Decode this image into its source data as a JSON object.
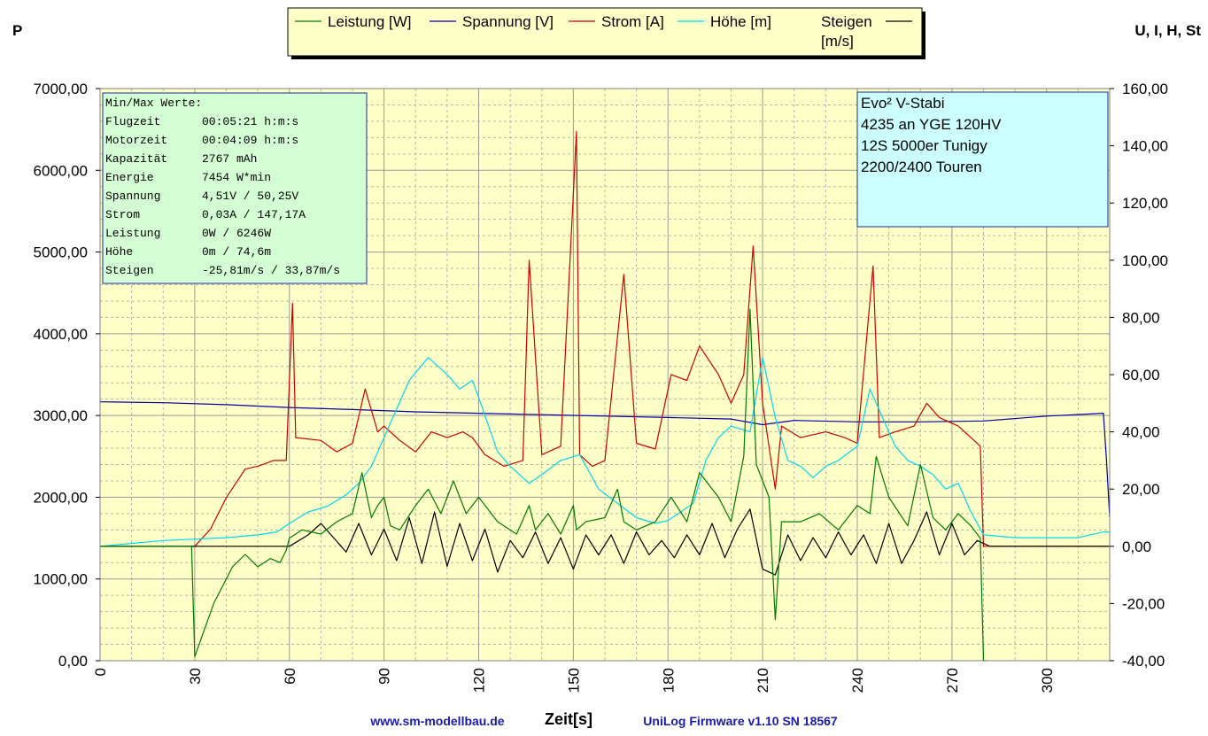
{
  "colors": {
    "leistung": "#007a00",
    "spannung": "#0000a0",
    "strom": "#cc0000",
    "hoehe": "#00d8ee",
    "steigen": "#000000",
    "plot_bg": "#ffffc8",
    "stats_bg": "#d4ffd4",
    "info_bg": "#ccffff",
    "footer": "#1a1aa8"
  },
  "labels": {
    "left_axis_title": "P",
    "right_axis_title": "U, I, H, St",
    "x_axis_title": "Zeit[s]",
    "footer_left": "www.sm-modellbau.de",
    "footer_right": "UniLog Firmware v1.10 SN 18567"
  },
  "legend": [
    {
      "key": "leistung",
      "label": "Leistung [W]"
    },
    {
      "key": "spannung",
      "label": "Spannung [V]"
    },
    {
      "key": "strom",
      "label": "Strom [A]"
    },
    {
      "key": "hoehe",
      "label": "Höhe [m]"
    },
    {
      "key": "steigen",
      "label": "Steigen\n[m/s]"
    }
  ],
  "stats_box": {
    "header": "Min/Max Werte:",
    "rows": [
      {
        "name": "Flugzeit",
        "value": "00:05:21 h:m:s"
      },
      {
        "name": "Motorzeit",
        "value": "00:04:09 h:m:s"
      },
      {
        "name": "Kapazität",
        "value": "2767 mAh"
      },
      {
        "name": "Energie",
        "value": "7454 W*min"
      },
      {
        "name": "Spannung",
        "value": "4,51V / 50,25V"
      },
      {
        "name": "Strom",
        "value": "0,03A / 147,17A"
      },
      {
        "name": "Leistung",
        "value": "0W / 6246W"
      },
      {
        "name": "Höhe",
        "value": "0m / 74,6m"
      },
      {
        "name": "Steigen",
        "value": "-25,81m/s / 33,87m/s"
      }
    ]
  },
  "info_box": {
    "lines": [
      "Evo²  V-Stabi",
      "4235 an YGE 120HV",
      "12S 5000er Tunigy",
      "2200/2400 Touren"
    ]
  },
  "chart_data": {
    "type": "line",
    "xlabel": "Zeit[s]",
    "ylabel_left": "P",
    "ylabel_right": "U, I, H, St",
    "xlim": [
      0,
      320
    ],
    "ylim_left": [
      0,
      7000
    ],
    "ylim_right": [
      -40,
      160
    ],
    "grid": true,
    "legend_position": "top-center",
    "x_ticks": [
      "0",
      "30",
      "60",
      "90",
      "120",
      "150",
      "180",
      "210",
      "240",
      "270",
      "300"
    ],
    "y_ticks_left": [
      "0,00",
      "1000,00",
      "2000,00",
      "3000,00",
      "4000,00",
      "5000,00",
      "6000,00",
      "7000,00"
    ],
    "y_ticks_right": [
      "-40,00",
      "-20,00",
      "0,00",
      "20,00",
      "40,00",
      "60,00",
      "80,00",
      "100,00",
      "120,00",
      "140,00",
      "160,00"
    ],
    "series": [
      {
        "name": "Leistung [W]",
        "axis": "left",
        "x": [
          0,
          29,
          30,
          36,
          42,
          46,
          50,
          54,
          57,
          59,
          60,
          64,
          70,
          75,
          80,
          83,
          86,
          88,
          90,
          92,
          95,
          100,
          104,
          108,
          112,
          116,
          120,
          126,
          132,
          136,
          138,
          142,
          146,
          150,
          151,
          154,
          160,
          164,
          166,
          170,
          176,
          181,
          186,
          190,
          196,
          200,
          204,
          206,
          208,
          212,
          214,
          216,
          222,
          228,
          234,
          240,
          244,
          246,
          250,
          256,
          260,
          264,
          268,
          272,
          276,
          279,
          280,
          281
        ],
        "y": [
          1400,
          1400,
          50,
          700,
          1150,
          1300,
          1150,
          1250,
          1200,
          1350,
          1500,
          1600,
          1550,
          1700,
          1800,
          2300,
          1750,
          1900,
          2000,
          1650,
          1600,
          1900,
          2100,
          1800,
          2200,
          1800,
          2000,
          1700,
          1550,
          1900,
          1600,
          1800,
          1550,
          1900,
          1600,
          1700,
          1750,
          2100,
          1700,
          1600,
          1700,
          2000,
          1700,
          2300,
          2000,
          1700,
          2500,
          4300,
          2400,
          2000,
          500,
          1700,
          1700,
          1800,
          1600,
          1900,
          1800,
          2500,
          2000,
          1650,
          2400,
          1750,
          1600,
          1800,
          1650,
          1500,
          0,
          0
        ]
      },
      {
        "name": "Spannung [V]",
        "axis": "right",
        "x": [
          0,
          20,
          40,
          60,
          80,
          100,
          120,
          140,
          160,
          180,
          200,
          210,
          220,
          240,
          260,
          280,
          300,
          318,
          319,
          320
        ],
        "y": [
          50.5,
          50.2,
          49.5,
          48.5,
          47.8,
          47.0,
          46.5,
          46.0,
          45.5,
          45.0,
          44.5,
          42.5,
          44.0,
          43.5,
          43.5,
          43.8,
          45.5,
          46.5,
          30,
          10
        ]
      },
      {
        "name": "Strom [A]",
        "axis": "right",
        "x": [
          0,
          30,
          35,
          40,
          46,
          50,
          55,
          59,
          61,
          62,
          70,
          75,
          80,
          84,
          88,
          90,
          95,
          100,
          105,
          110,
          115,
          118,
          122,
          128,
          134,
          136,
          140,
          146,
          151,
          152,
          156,
          160,
          166,
          170,
          176,
          181,
          186,
          190,
          196,
          200,
          204,
          207,
          210,
          214,
          216,
          222,
          230,
          236,
          240,
          245,
          247,
          252,
          258,
          262,
          266,
          272,
          276,
          279,
          280,
          281,
          320
        ],
        "y": [
          0,
          0,
          6,
          17,
          27,
          28,
          30,
          30,
          85,
          38,
          37,
          33,
          36,
          55,
          40,
          42,
          37,
          33,
          40,
          38,
          40,
          38,
          32,
          28,
          30,
          100,
          32,
          35,
          145,
          32,
          28,
          30,
          95,
          36,
          34,
          60,
          58,
          70,
          60,
          50,
          60,
          105,
          50,
          20,
          42,
          38,
          40,
          38,
          36,
          98,
          38,
          40,
          42,
          50,
          45,
          42,
          38,
          35,
          0,
          0,
          0
        ]
      },
      {
        "name": "Höhe [m]",
        "axis": "right",
        "x": [
          0,
          20,
          40,
          50,
          56,
          60,
          66,
          72,
          78,
          82,
          86,
          90,
          94,
          98,
          104,
          110,
          114,
          118,
          120,
          126,
          130,
          136,
          140,
          146,
          152,
          158,
          164,
          170,
          176,
          180,
          184,
          188,
          192,
          196,
          200,
          206,
          210,
          214,
          218,
          222,
          226,
          230,
          234,
          240,
          244,
          248,
          252,
          256,
          260,
          264,
          268,
          272,
          276,
          280,
          290,
          300,
          310,
          318,
          320
        ],
        "y": [
          0,
          2,
          3,
          4,
          5,
          8,
          12,
          14,
          18,
          22,
          28,
          38,
          48,
          58,
          66,
          60,
          55,
          58,
          52,
          33,
          28,
          22,
          25,
          30,
          32,
          20,
          15,
          10,
          8,
          9,
          12,
          15,
          30,
          38,
          42,
          40,
          66,
          45,
          30,
          28,
          24,
          28,
          30,
          35,
          55,
          45,
          35,
          30,
          28,
          25,
          20,
          22,
          12,
          4,
          3,
          3,
          3,
          5,
          5
        ]
      },
      {
        "name": "Steigen [m/s]",
        "axis": "right",
        "x": [
          0,
          40,
          56,
          60,
          66,
          70,
          74,
          78,
          82,
          86,
          90,
          94,
          98,
          102,
          106,
          110,
          114,
          118,
          122,
          126,
          130,
          134,
          138,
          142,
          146,
          150,
          154,
          158,
          162,
          166,
          170,
          174,
          178,
          182,
          186,
          190,
          194,
          198,
          202,
          206,
          210,
          214,
          218,
          222,
          226,
          230,
          234,
          238,
          242,
          246,
          250,
          254,
          258,
          262,
          266,
          270,
          274,
          278,
          282,
          290,
          320
        ],
        "y": [
          0,
          0,
          0,
          0,
          4,
          8,
          3,
          -2,
          8,
          -3,
          6,
          -5,
          10,
          -6,
          12,
          -7,
          8,
          -5,
          6,
          -9,
          2,
          -4,
          5,
          -6,
          3,
          -8,
          4,
          -3,
          4,
          -6,
          5,
          -3,
          2,
          -4,
          4,
          -3,
          8,
          -4,
          6,
          13,
          -8,
          -10,
          4,
          -5,
          3,
          -4,
          5,
          -3,
          4,
          -6,
          8,
          -6,
          2,
          12,
          -3,
          8,
          -3,
          2,
          0,
          0,
          0
        ]
      }
    ]
  }
}
